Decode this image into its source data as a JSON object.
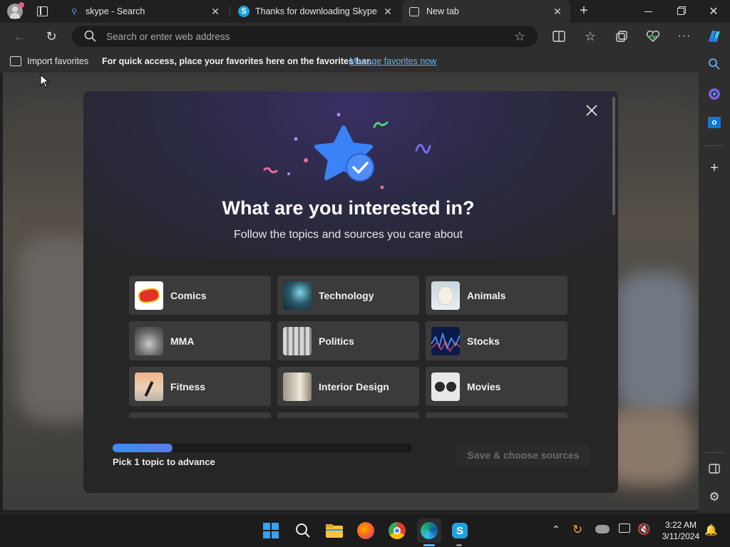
{
  "tabs": [
    {
      "title": "skype - Search",
      "icon": "search-icon"
    },
    {
      "title": "Thanks for downloading Skype",
      "icon": "skype-icon"
    },
    {
      "title": "New tab",
      "icon": "new-tab-page-icon",
      "active": true
    }
  ],
  "address_bar": {
    "placeholder": "Search or enter web address"
  },
  "favorites_bar": {
    "import_label": "Import favorites",
    "hint_text": "For quick access, place your favorites here on the favorites bar.",
    "manage_link": "Manage favorites now"
  },
  "modal": {
    "title": "What are you interested in?",
    "subtitle": "Follow the topics and sources you care about",
    "topics": [
      {
        "label": "Comics"
      },
      {
        "label": "Technology"
      },
      {
        "label": "Animals"
      },
      {
        "label": "MMA"
      },
      {
        "label": "Politics"
      },
      {
        "label": "Stocks"
      },
      {
        "label": "Fitness"
      },
      {
        "label": "Interior Design"
      },
      {
        "label": "Movies"
      }
    ],
    "progress": {
      "fraction": 0.2,
      "label": "Pick 1 topic to advance"
    },
    "save_button": "Save & choose sources"
  },
  "taskbar": {
    "time": "3:22 AM",
    "date": "3/11/2024"
  },
  "colors": {
    "accent": "#3a8ef0",
    "link": "#6cb2f0",
    "star": "#3b82f6"
  }
}
